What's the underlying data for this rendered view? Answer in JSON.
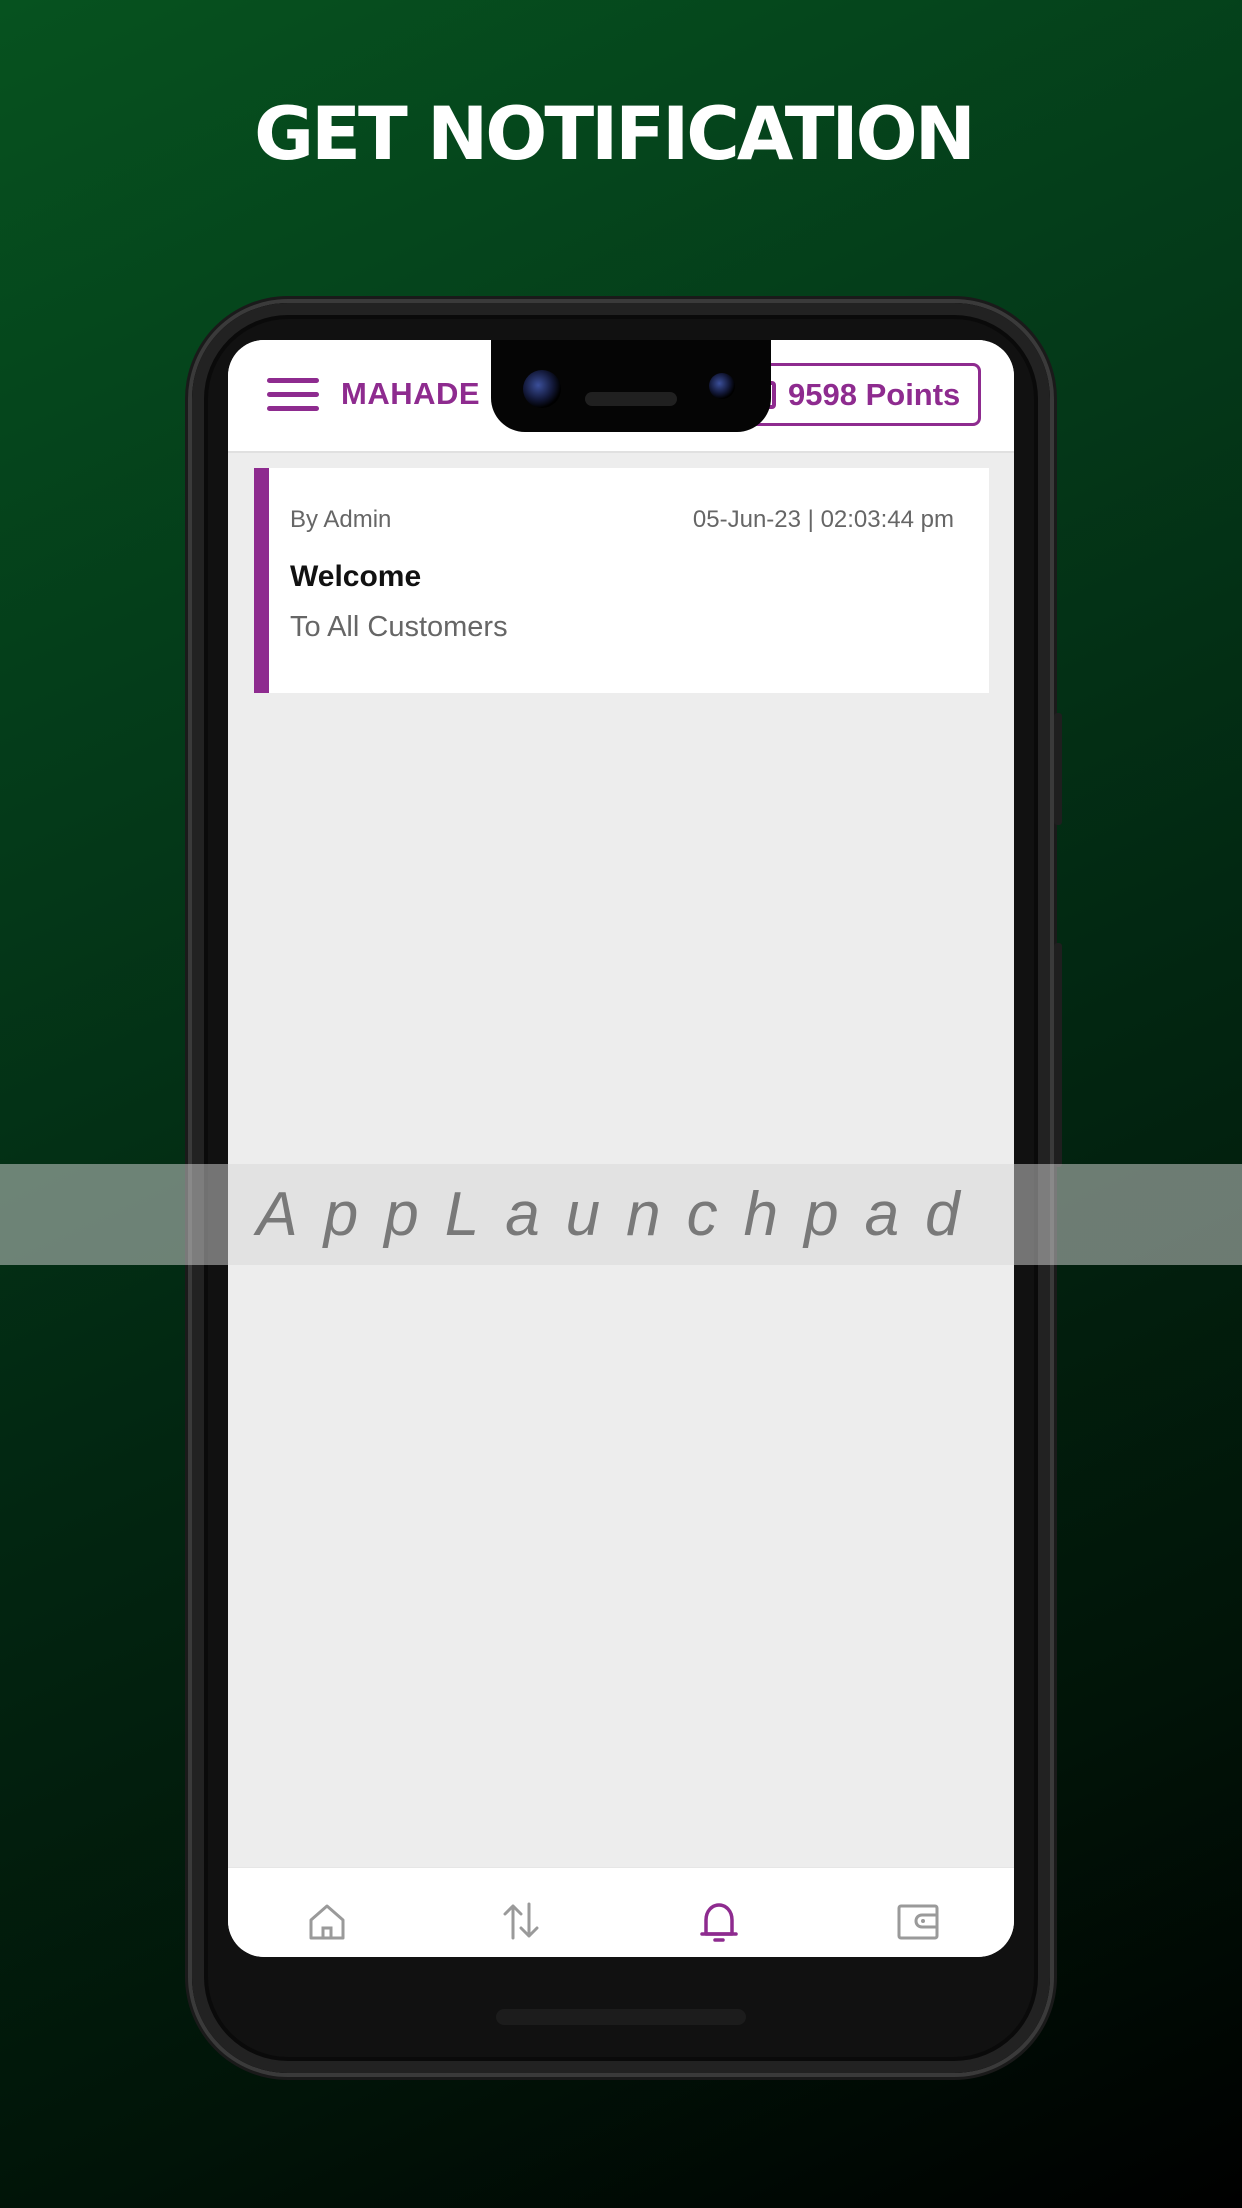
{
  "headline": "GET NOTIFICATION",
  "app": {
    "brand": "MAHADE",
    "points_label": "9598 Points",
    "accent_color": "#8e2b8f"
  },
  "notifications": [
    {
      "by": "By Admin",
      "datetime": "05-Jun-23 | 02:03:44 pm",
      "title": "Welcome",
      "message": "To All Customers"
    }
  ],
  "bottom_nav": {
    "items": [
      {
        "icon": "home-icon",
        "active": false
      },
      {
        "icon": "transfer-arrows-icon",
        "active": false
      },
      {
        "icon": "bell-icon",
        "active": true
      },
      {
        "icon": "wallet-icon",
        "active": false
      }
    ]
  },
  "watermark": "AppLaunchpad"
}
